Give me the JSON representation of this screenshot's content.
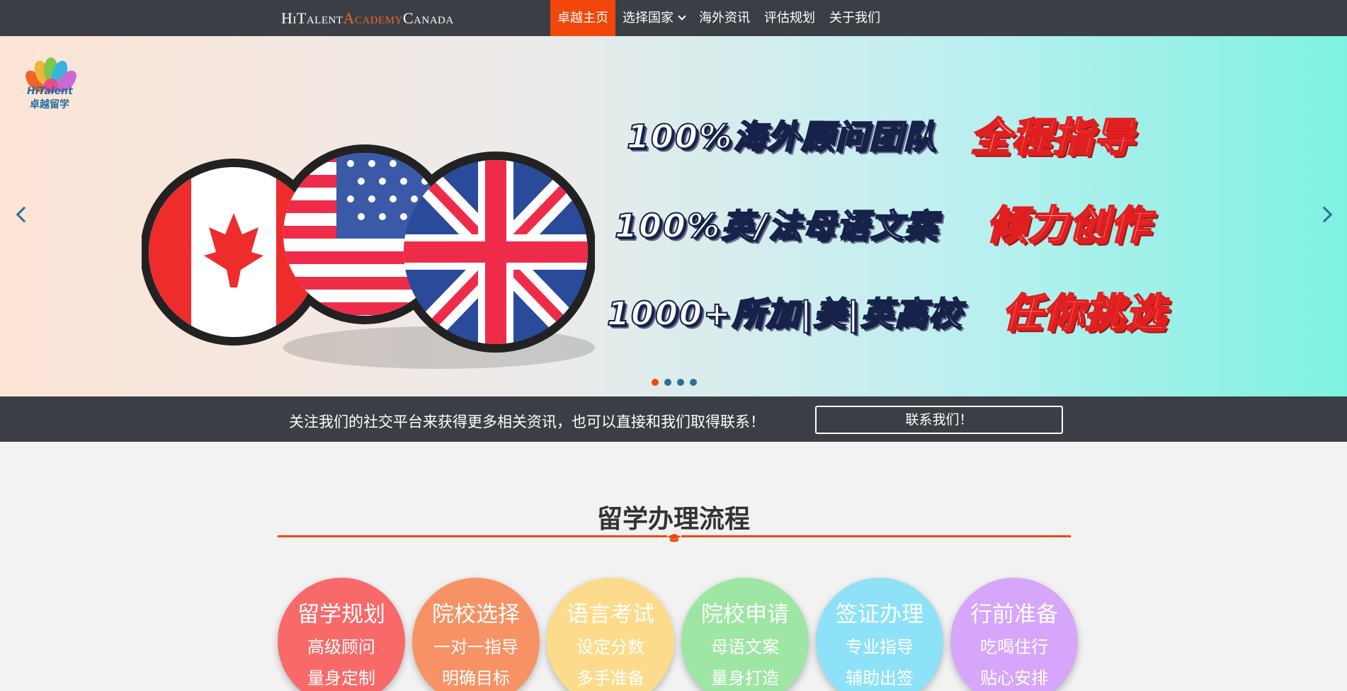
{
  "brand": {
    "part1": "HiTalent",
    "part2": "Academy",
    "part3": "Canada"
  },
  "nav": {
    "items": [
      {
        "label": "卓越主页",
        "active": true
      },
      {
        "label": "选择国家",
        "dropdown": true
      },
      {
        "label": "海外资讯"
      },
      {
        "label": "评估规划"
      },
      {
        "label": "关于我们"
      }
    ]
  },
  "hero": {
    "logo_text_en": "HiTalent",
    "logo_text_cn": "卓越留学",
    "slogans": {
      "line1_left": "100%海外顾问团队",
      "line1_right": "全程指导",
      "line2_left": "100%英/法母语文案",
      "line2_right": "倾力创作",
      "line3_left": "1000+所加|美|英高校",
      "line3_right": "任你挑选"
    },
    "slides": {
      "count": 4,
      "active_index": 0
    },
    "icons": {
      "prev": "chevron-left-icon",
      "next": "chevron-right-icon"
    }
  },
  "social": {
    "text": "关注我们的社交平台来获得更多相关资讯，也可以直接和我们取得联系！",
    "button_label": "联系我们！"
  },
  "process": {
    "title": "留学办理流程",
    "steps": [
      {
        "title": "留学规划",
        "line1": "高级顾问",
        "line2": "量身定制",
        "color": "#f86a6a"
      },
      {
        "title": "院校选择",
        "line1": "一对一指导",
        "line2": "明确目标",
        "color": "#f79264"
      },
      {
        "title": "语言考试",
        "line1": "设定分数",
        "line2": "多手准备",
        "color": "#fcdc8c"
      },
      {
        "title": "院校申请",
        "line1": "母语文案",
        "line2": "量身打造",
        "color": "#9ee6a4"
      },
      {
        "title": "签证办理",
        "line1": "专业指导",
        "line2": "辅助出签",
        "color": "#8ee2f8"
      },
      {
        "title": "行前准备",
        "line1": "吃喝住行",
        "line2": "贴心安排",
        "color": "#d6a6fa"
      }
    ]
  },
  "colors": {
    "nav_bg": "#3b3f45",
    "accent": "#f3460a",
    "link_blue": "#2d6f9c"
  }
}
